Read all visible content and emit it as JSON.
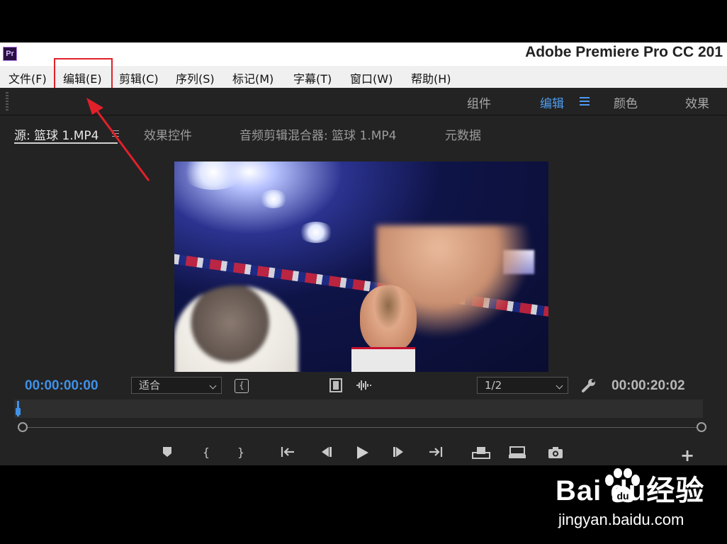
{
  "window": {
    "app_icon": "Pr",
    "title": "Adobe Premiere Pro CC 201"
  },
  "menubar": {
    "items": [
      "文件(F)",
      "编辑(E)",
      "剪辑(C)",
      "序列(S)",
      "标记(M)",
      "字幕(T)",
      "窗口(W)",
      "帮助(H)"
    ],
    "highlighted": "编辑(E)",
    "highlight_color": "#e1202a"
  },
  "workspaces": {
    "tabs": [
      "组件",
      "编辑",
      "颜色",
      "效果"
    ],
    "active": "编辑",
    "active_color": "#4d9cf0"
  },
  "source_panel": {
    "tabs": [
      "源: 篮球 1.MP4",
      "效果控件",
      "音频剪辑混合器: 篮球 1.MP4",
      "元数据"
    ],
    "active": "源: 篮球 1.MP4",
    "current_timecode": "00:00:00:00",
    "duration_timecode": "00:00:20:02",
    "zoom_select": "适合",
    "resolution_select": "1/2",
    "playhead_position": 0
  },
  "icons": {
    "mark_in_out": "insert-brackets-icon",
    "drag_video": "film-icon",
    "drag_audio": "waveform-icon",
    "settings": "wrench-icon",
    "transport": [
      "marker-icon",
      "mark-in-icon",
      "mark-out-icon",
      "go-to-in-icon",
      "step-back-icon",
      "play-icon",
      "step-forward-icon",
      "go-to-out-icon",
      "insert-icon",
      "overwrite-icon",
      "export-frame-icon",
      "add-button-icon"
    ]
  },
  "watermark": {
    "logo": "Bai  du经验",
    "url": "jingyan.baidu.com"
  }
}
